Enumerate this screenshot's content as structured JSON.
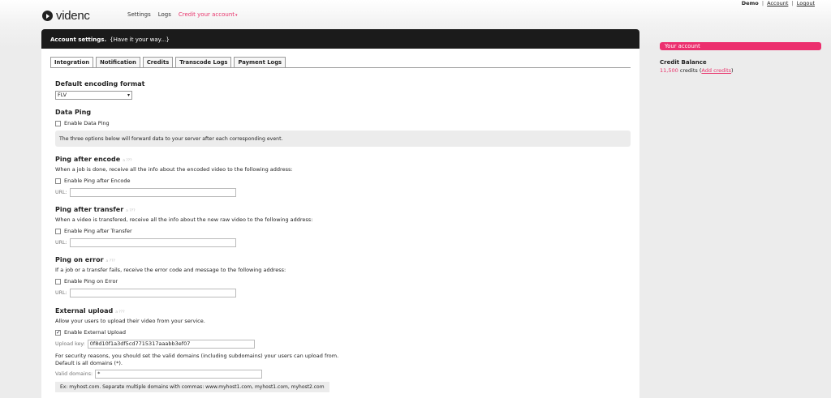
{
  "user": {
    "name": "Demo",
    "account": "Account",
    "logout": "Logout",
    "sep": "|"
  },
  "brand": {
    "name": "videnc"
  },
  "nav": [
    {
      "label": "Settings"
    },
    {
      "label": "Logs"
    },
    {
      "label": "Credit your account"
    }
  ],
  "panel": {
    "title": "Account settings.",
    "subtitle": "{Have it your way...}"
  },
  "tabs": [
    "Integration",
    "Notification",
    "Credits",
    "Transcode Logs",
    "Payment Logs"
  ],
  "encoding": {
    "heading": "Default encoding format",
    "selected": "FLV"
  },
  "data_ping": {
    "heading": "Data Ping",
    "checkbox": "Enable Data Ping",
    "note": "The three options below will forward data to your server after each corresponding event."
  },
  "ping_encode": {
    "heading": "Ping after encode",
    "hint": "a ???",
    "desc": "When a job is done, receive all the info about the encoded video to the following address:",
    "checkbox": "Enable Ping after Encode",
    "url_label": "URL:",
    "url_value": ""
  },
  "ping_transfer": {
    "heading": "Ping after transfer",
    "hint": "a ???",
    "desc": "When a video is transfered, receive all the info about the new raw video to the following address:",
    "checkbox": "Enable Ping after Transfer",
    "url_label": "URL:",
    "url_value": ""
  },
  "ping_error": {
    "heading": "Ping on error",
    "hint": "a ???",
    "desc": "If a job or a transfer fails, receive the error code and message to the following address:",
    "checkbox": "Enable Ping on Error",
    "url_label": "URL:",
    "url_value": ""
  },
  "external_upload": {
    "heading": "External upload",
    "hint": "a ???",
    "desc": "Allow your users to upload their video from your service.",
    "checkbox": "Enable External Upload",
    "checked": true,
    "key_label": "Upload key:",
    "key_value": "0f8d10f1a3df5cd7715317aaabb3ef07",
    "security_line1": "For security reasons, you should set the valid domains (including subdomains) your users can upload from.",
    "security_line2": "Default is all domains (*).",
    "domains_label": "Valid domains:",
    "domains_value": "*",
    "example": "Ex: myhost.com. Separate multiple domains with commas: www.myhost1.com, myhost1.com, myhost2.com"
  },
  "sidebar": {
    "heading": "Your account",
    "balance_title": "Credit Balance",
    "credits_amount": "11,500",
    "credits_word": "credits",
    "add_credits": "Add credits"
  }
}
